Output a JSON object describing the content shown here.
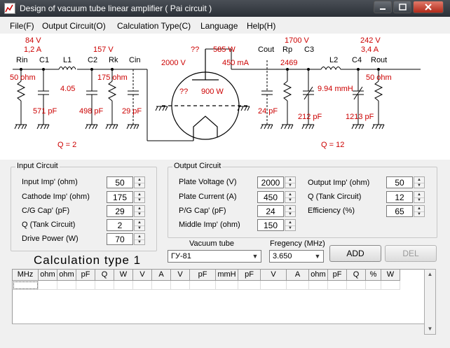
{
  "window": {
    "title": "Design of vacuum tube linear amplifier ( Pai circuit )"
  },
  "menu": [
    "File(F)",
    "Output Circuit(O)",
    "Calculation Type(C)",
    "Language",
    "Help(H)"
  ],
  "schematic": {
    "labels": {
      "rin": "Rin",
      "c1": "C1",
      "l1": "L1",
      "c2": "C2",
      "rk": "Rk",
      "cin": "Cin",
      "cout": "Cout",
      "rp": "Rp",
      "c3": "C3",
      "l2": "L2",
      "c4": "C4",
      "rout": "Rout"
    },
    "values": {
      "in_voltage": "84 V",
      "in_current": "1,2 A",
      "c2_voltage": "157 V",
      "rin_ohm": "50 ohm",
      "l1_value": "4.05",
      "rk_ohm": "175 ohm",
      "c1_pf": "571 pF",
      "c2_pf": "498 pF",
      "cin_pf": "29 pF",
      "q_in": "Q = 2",
      "plate_supply": "2000 V",
      "grid_unknown": "??",
      "plate_power": "585 W",
      "plate_current": "450 mA",
      "cathode_unknown": "??",
      "output_power": "900 W",
      "rp_voltage": "1700 V",
      "rp_value": "2469",
      "out_voltage": "242 V",
      "out_current": "3,4 A",
      "rout_ohm": "50 ohm",
      "l2_value": "9.94 mmH",
      "cout_pf": "24 pF",
      "c3_pf": "212 pF",
      "c4_pf": "1213 pF",
      "q_out": "Q = 12"
    },
    "colors": {
      "value_red": "#cc0000"
    }
  },
  "input_circuit": {
    "title": "Input Circuit",
    "fields": [
      {
        "label": "Input Imp' (ohm)",
        "value": "50"
      },
      {
        "label": "Cathode Imp' (ohm)",
        "value": "175"
      },
      {
        "label": "C/G Cap' (pF)",
        "value": "29"
      },
      {
        "label": "Q (Tank Circuit)",
        "value": "2"
      },
      {
        "label": "Drive Power (W)",
        "value": "70"
      }
    ]
  },
  "output_circuit": {
    "title": "Output Circuit",
    "left_fields": [
      {
        "label": "Plate Voltage (V)",
        "value": "2000"
      },
      {
        "label": "Plate Current (A)",
        "value": "450"
      },
      {
        "label": "P/G Cap' (pF)",
        "value": "24"
      },
      {
        "label": "Middle Imp' (ohm)",
        "value": "150"
      }
    ],
    "right_fields": [
      {
        "label": "Output Imp' (ohm)",
        "value": "50"
      },
      {
        "label": "Q (Tank Circuit)",
        "value": "12"
      },
      {
        "label": "Efficiency (%)",
        "value": "65"
      }
    ]
  },
  "tube": {
    "label": "Vacuum tube",
    "value": "ГУ-81"
  },
  "frequency": {
    "label": "Fregency (MHz)",
    "value": "3.650"
  },
  "buttons": {
    "add": "ADD",
    "del": "DEL"
  },
  "calc_title": "Calculation type 1",
  "table": {
    "headers": [
      "MHz",
      "ohm",
      "ohm",
      "pF",
      "Q",
      "W",
      "V",
      "A",
      "V",
      "pF",
      "mmH",
      "pF",
      "V",
      "A",
      "ohm",
      "pF",
      "Q",
      "%",
      "W"
    ]
  }
}
